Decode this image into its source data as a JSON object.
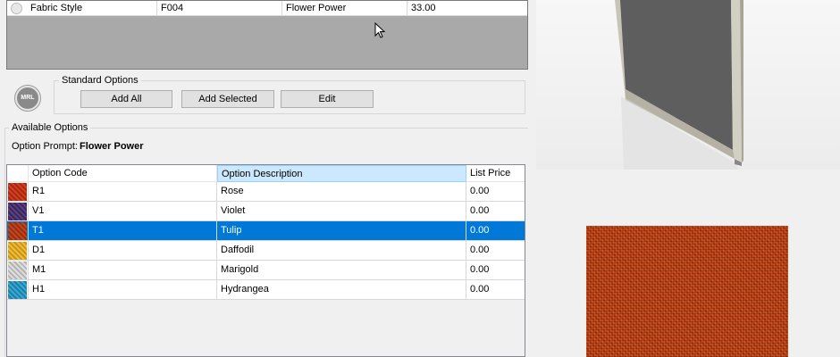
{
  "top_grid": {
    "row": {
      "name": "Fabric Style",
      "code": "F004",
      "description": "Flower Power",
      "price": "33.00"
    }
  },
  "logo": {
    "text": "MRL"
  },
  "standard_options": {
    "legend": "Standard Options",
    "add_all": "Add All",
    "add_selected": "Add Selected",
    "edit": "Edit"
  },
  "available": {
    "legend": "Available Options",
    "prompt_label": "Option Prompt:",
    "prompt_value": "Flower Power"
  },
  "options_table": {
    "headers": {
      "code": "Option Code",
      "description": "Option Description",
      "price": "List Price"
    },
    "rows": [
      {
        "code": "R1",
        "description": "Rose",
        "price": "0.00",
        "swatch_color": "#c8341c"
      },
      {
        "code": "V1",
        "description": "Violet",
        "price": "0.00",
        "swatch_color": "#4a3470"
      },
      {
        "code": "T1",
        "description": "Tulip",
        "price": "0.00",
        "swatch_color": "#b53a18",
        "selected": true
      },
      {
        "code": "D1",
        "description": "Daffodil",
        "price": "0.00",
        "swatch_color": "#e0b02a"
      },
      {
        "code": "M1",
        "description": "Marigold",
        "price": "0.00",
        "swatch_color": "#c9c9c9"
      },
      {
        "code": "H1",
        "description": "Hydrangea",
        "price": "0.00",
        "swatch_color": "#2a9ac4"
      }
    ]
  },
  "colors": {
    "selection": "#0078d7",
    "sorted_header": "#cce8ff",
    "fabric_sample": "#b8400f",
    "panel_fabric": "#5e5e5e"
  }
}
